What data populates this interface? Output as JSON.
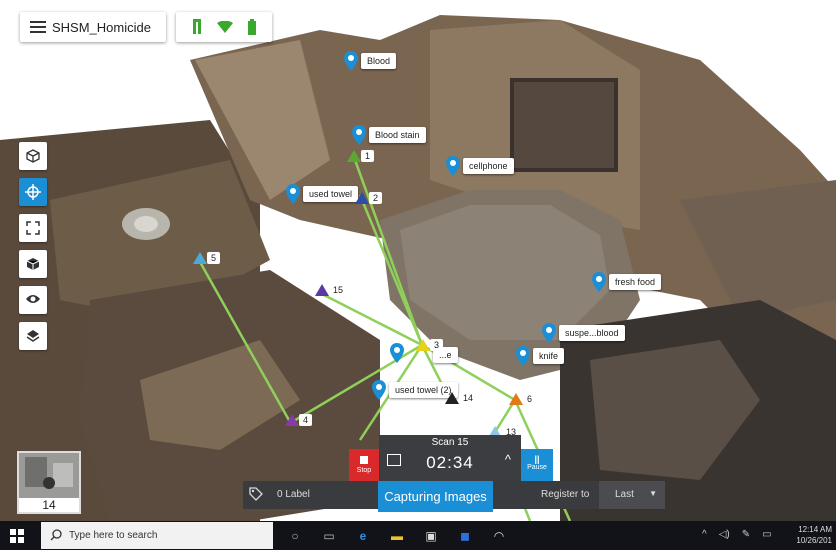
{
  "app": {
    "title": "SHSM_Homicide"
  },
  "pins": [
    {
      "label": "Blood"
    },
    {
      "label": "Blood stain"
    },
    {
      "label": "cellphone"
    },
    {
      "label": "used towel"
    },
    {
      "label": "fresh food"
    },
    {
      "label": "suspe...blood"
    },
    {
      "label": "knife"
    },
    {
      "label": "used towel (2)"
    },
    {
      "label": "...e"
    }
  ],
  "markers": [
    {
      "num": "1"
    },
    {
      "num": "2"
    },
    {
      "num": "5"
    },
    {
      "num": "15"
    },
    {
      "num": "3"
    },
    {
      "num": "4"
    },
    {
      "num": "14"
    },
    {
      "num": "6"
    },
    {
      "num": "13"
    }
  ],
  "thumbnail": {
    "label": "14"
  },
  "scan": {
    "name": "Scan 15",
    "time": "02:34",
    "stop_label": "Stop",
    "pause_label": "Pause"
  },
  "bottom": {
    "label_count": "0 Label",
    "capturing": "Capturing Images",
    "register_to": "Register to",
    "register_value": "Last"
  },
  "taskbar": {
    "search_placeholder": "Type here to search",
    "time": "12:14 AM",
    "date": "10/26/201"
  },
  "colors": {
    "accent": "#1a8fd6",
    "stop": "#d9292b",
    "link_line": "#8ed05a"
  }
}
